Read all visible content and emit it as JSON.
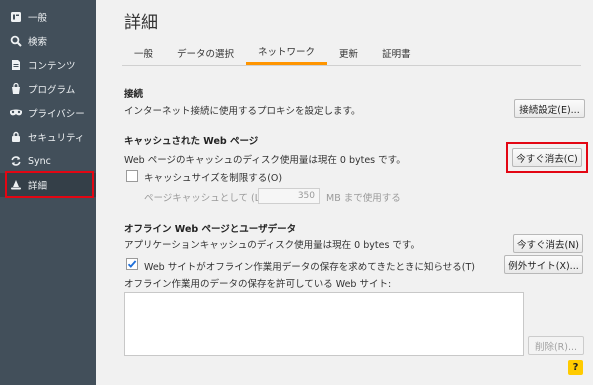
{
  "sidebar": {
    "items": [
      {
        "icon": "general-icon",
        "label": "一般"
      },
      {
        "icon": "search-icon",
        "label": "検索"
      },
      {
        "icon": "content-icon",
        "label": "コンテンツ"
      },
      {
        "icon": "applications-icon",
        "label": "プログラム"
      },
      {
        "icon": "privacy-mask-icon",
        "label": "プライバシー"
      },
      {
        "icon": "security-lock-icon",
        "label": "セキュリティ"
      },
      {
        "icon": "sync-icon",
        "label": "Sync"
      },
      {
        "icon": "advanced-wizard-hat-icon",
        "label": "詳細"
      }
    ],
    "active_index": 7
  },
  "main": {
    "title": "詳細",
    "tabs": [
      "一般",
      "データの選択",
      "ネットワーク",
      "更新",
      "証明書"
    ],
    "active_tab": "ネットワーク",
    "connection": {
      "heading": "接続",
      "description": "インターネット接続に使用するプロキシを設定します。",
      "button": "接続設定(E)..."
    },
    "cache": {
      "heading": "キャッシュされた Web ページ",
      "description": "Web ページのキャッシュのディスク使用量は現在 0 bytes です。",
      "clear_button": "今すぐ消去(C)",
      "override_label": "キャッシュサイズを制限する(O)",
      "override_checked": false,
      "limit_label": "ページキャッシュとして (L)",
      "limit_value": "350",
      "limit_unit": "MB まで使用する"
    },
    "offline": {
      "heading": "オフライン Web ページとユーザデータ",
      "description": "アプリケーションキャッシュのディスク使用量は現在 0 bytes です。",
      "clear_button": "今すぐ消去(N)",
      "notify_label": "Web サイトがオフライン作業用データの保存を求めてきたときに知らせる(T)",
      "notify_checked": true,
      "exceptions_button": "例外サイト(X)...",
      "list_label": "オフライン作業用のデータの保存を許可している Web サイト:",
      "remove_button": "削除(R)..."
    },
    "help_label": "?"
  },
  "colors": {
    "sidebar_bg": "#424f5a",
    "accent_tab": "#ff9500",
    "highlight": "#e30613",
    "help_button": "#ffcb00"
  }
}
